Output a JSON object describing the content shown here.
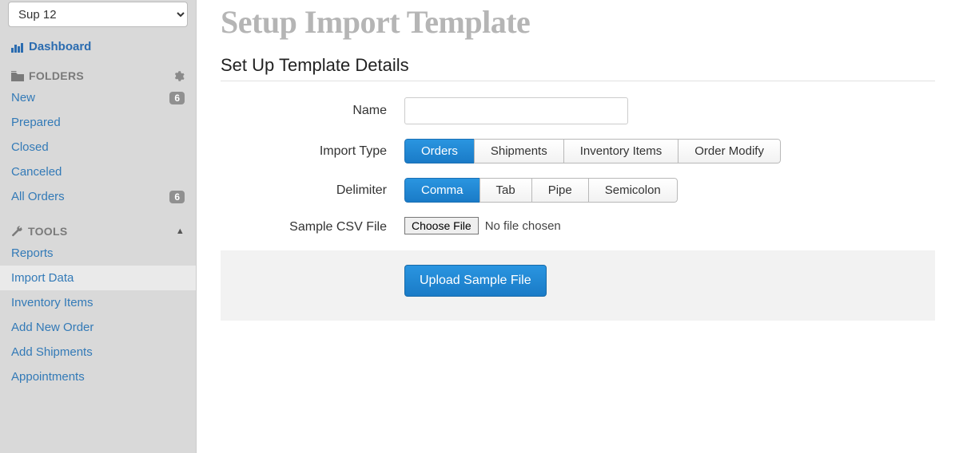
{
  "sidebar": {
    "supplier_selected": "Sup 12",
    "dashboard_label": "Dashboard",
    "folders_header": "FOLDERS",
    "tools_header": "TOOLS",
    "folders": [
      {
        "label": "New",
        "badge": "6"
      },
      {
        "label": "Prepared",
        "badge": ""
      },
      {
        "label": "Closed",
        "badge": ""
      },
      {
        "label": "Canceled",
        "badge": ""
      },
      {
        "label": "All Orders",
        "badge": "6"
      }
    ],
    "tools": [
      {
        "label": "Reports"
      },
      {
        "label": "Import Data"
      },
      {
        "label": "Inventory Items"
      },
      {
        "label": "Add New Order"
      },
      {
        "label": "Add Shipments"
      },
      {
        "label": "Appointments"
      }
    ],
    "active_tool_index": 1
  },
  "main": {
    "page_title": "Setup Import Template",
    "section_title": "Set Up Template Details",
    "labels": {
      "name": "Name",
      "import_type": "Import Type",
      "delimiter": "Delimiter",
      "sample_csv": "Sample CSV File"
    },
    "name_value": "",
    "import_type": {
      "options": [
        "Orders",
        "Shipments",
        "Inventory Items",
        "Order Modify"
      ],
      "selected_index": 0
    },
    "delimiter": {
      "options": [
        "Comma",
        "Tab",
        "Pipe",
        "Semicolon"
      ],
      "selected_index": 0
    },
    "file": {
      "choose_label": "Choose File",
      "status": "No file chosen"
    },
    "upload_button": "Upload Sample File"
  }
}
